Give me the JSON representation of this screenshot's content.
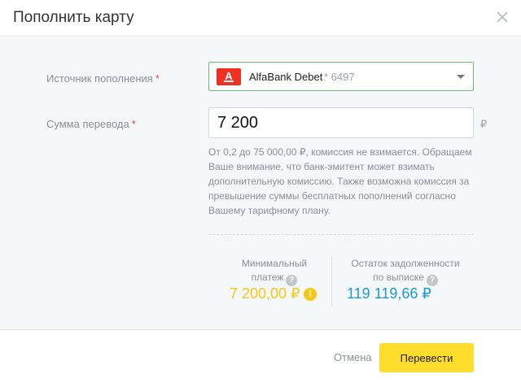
{
  "dialog": {
    "title": "Пополнить карту",
    "close_icon": "close-icon"
  },
  "form": {
    "source": {
      "label": "Источник пополнения",
      "required_mark": "*",
      "bank_logo_letter": "А",
      "bank_logo_color": "#ef3124",
      "card_name": "AlfaBank Debet",
      "card_mask": "* 6497"
    },
    "amount": {
      "label": "Сумма перевода",
      "required_mark": "*",
      "value": "7 200",
      "currency": "₽"
    },
    "hint": "От 0,2 до 75 000,00 ₽, комиссия не взимается. Обращаем Ваше внимание, что банк-эмитент может взимать дополнительную комиссию. Также возможна комиссия за превышение суммы бесплатных пополнений согласно Вашему тарифному плану."
  },
  "stats": {
    "min_payment": {
      "label_line1": "Минимальный",
      "label_line2": "платеж",
      "value": "7 200,00 ₽",
      "value_color": "#f4c815",
      "help_icon": "question-icon",
      "warn_icon": "exclamation-icon"
    },
    "debt_balance": {
      "label_line1": "Остаток задолженности",
      "label_line2": "по выписке",
      "value": "119 119,66 ₽",
      "value_color": "#1a9ad6",
      "help_icon": "question-icon"
    }
  },
  "footer": {
    "cancel_label": "Отмена",
    "submit_label": "Перевести",
    "submit_color": "#ffdd2d"
  }
}
